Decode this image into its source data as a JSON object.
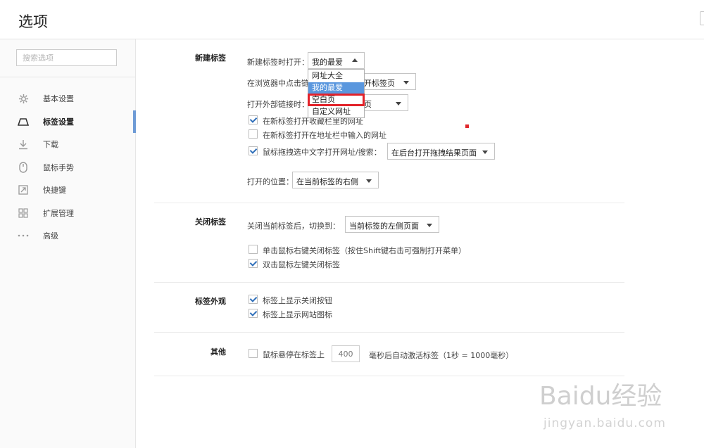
{
  "header": {
    "title": "选项"
  },
  "sidebar": {
    "search_placeholder": "搜索选项",
    "items": [
      {
        "label": "基本设置",
        "icon": "gear-icon",
        "active": false
      },
      {
        "label": "标签设置",
        "icon": "tab-icon",
        "active": true
      },
      {
        "label": "下载",
        "icon": "download-icon",
        "active": false
      },
      {
        "label": "鼠标手势",
        "icon": "mouse-icon",
        "active": false
      },
      {
        "label": "快捷键",
        "icon": "shortcut-icon",
        "active": false
      },
      {
        "label": "扩展管理",
        "icon": "extensions-icon",
        "active": false
      },
      {
        "label": "高级",
        "icon": "more-icon",
        "active": false
      }
    ]
  },
  "new_tab": {
    "section": "新建标签",
    "open_label": "新建标签时打开：",
    "open_value": "我的最爱",
    "click_link_label": "在浏览器中点击链",
    "click_link_value": "开标签页",
    "external_link_label": "打开外部链接时：",
    "external_link_value": "页",
    "popup_options": [
      "网址大全",
      "我的最爱",
      "空白页",
      "自定义网址"
    ],
    "popup_selected": "我的最爱",
    "popup_boxed": "空白页",
    "cb_favorites": "在新标签打开收藏栏里的网址",
    "cb_favorites_checked": true,
    "cb_addressbar": "在新标签打开在地址栏中输入的网址",
    "cb_addressbar_checked": false,
    "cb_drag": "鼠标拖拽选中文字打开网址/搜索：",
    "cb_drag_checked": true,
    "drag_value": "在后台打开拖拽结果页面",
    "position_label": "打开的位置：",
    "position_value": "在当前标签的右侧"
  },
  "close_tab": {
    "section": "关闭标签",
    "switch_label": "关闭当前标签后，切换到：",
    "switch_value": "当前标签的左侧页面",
    "cb_right_click": "单击鼠标右键关闭标签（按住Shift键右击可强制打开菜单）",
    "cb_right_click_checked": false,
    "cb_double_click": "双击鼠标左键关闭标签",
    "cb_double_click_checked": true
  },
  "appearance": {
    "section": "标签外观",
    "cb_close_button": "标签上显示关闭按钮",
    "cb_close_button_checked": true,
    "cb_site_icon": "标签上显示网站图标",
    "cb_site_icon_checked": true
  },
  "other": {
    "section": "其他",
    "cb_hover": "鼠标悬停在标签上",
    "cb_hover_checked": false,
    "hover_ms": "400",
    "hover_suffix": "毫秒后自动激活标签（1秒 = 1000毫秒）"
  },
  "watermark": {
    "text": "Baidu经验",
    "sub": "jingyan.baidu.com"
  },
  "colors": {
    "accent": "#6e9bd6",
    "highlight": "#5a97de",
    "annotation": "#e2222a",
    "check": "#2f6fba"
  }
}
